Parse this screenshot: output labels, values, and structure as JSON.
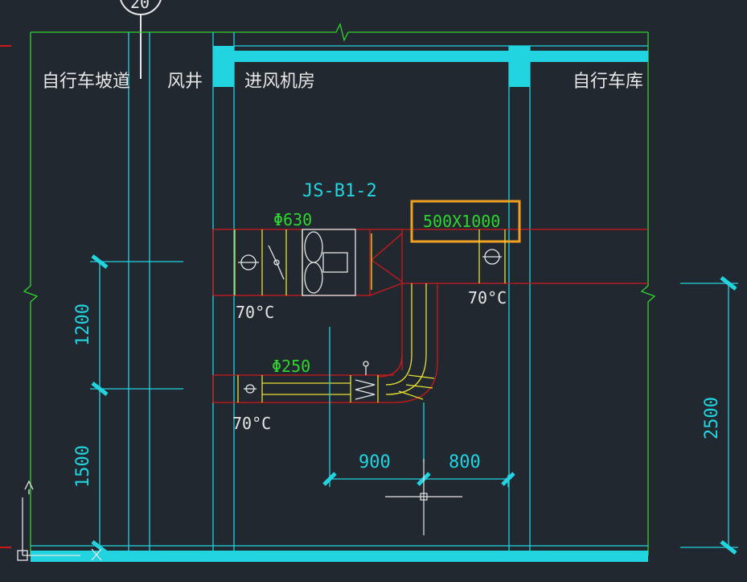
{
  "rooms": {
    "bike_ramp": "自行车坡道",
    "air_shaft": "风井",
    "intake_room": "进风机房",
    "bike_garage": "自行车库"
  },
  "equipment": {
    "unit_tag": "JS-B1-2",
    "duct_main_size": "Φ630",
    "duct_rect_size": "500X1000",
    "duct_small_size": "Φ250",
    "damper_temp_1": "70°C",
    "damper_temp_2": "70°C",
    "damper_temp_3": "70°C"
  },
  "dimensions": {
    "left_upper": "1200",
    "left_lower": "1500",
    "bottom_left": "900",
    "bottom_right": "800",
    "right_total": "2500"
  },
  "axis_bubble": "20",
  "ucs": {
    "y_label": "Y",
    "x_label": "X"
  },
  "colors": {
    "background": "#212830",
    "wall_green": "#2fd42f",
    "cyan": "#22d3e0",
    "duct_red": "#d01818",
    "duct_yellow": "#e8e030",
    "highlight": "#f0a020"
  }
}
